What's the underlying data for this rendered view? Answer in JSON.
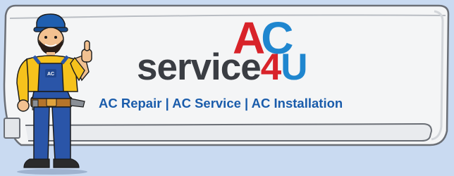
{
  "logo": {
    "ac_a": "A",
    "ac_c": "C",
    "word_main": "service",
    "word_num": "4",
    "word_u": "U"
  },
  "tagline": "AC Repair | AC Service | AC Installation",
  "mechanic": {
    "bib_badge": "AC"
  },
  "colors": {
    "background": "#c9daf1",
    "unit_body": "#f4f5f6",
    "brand_red": "#d8232a",
    "brand_blue": "#1f86cf",
    "text_dark": "#3a3d43",
    "tagline_blue": "#1a5cab"
  }
}
